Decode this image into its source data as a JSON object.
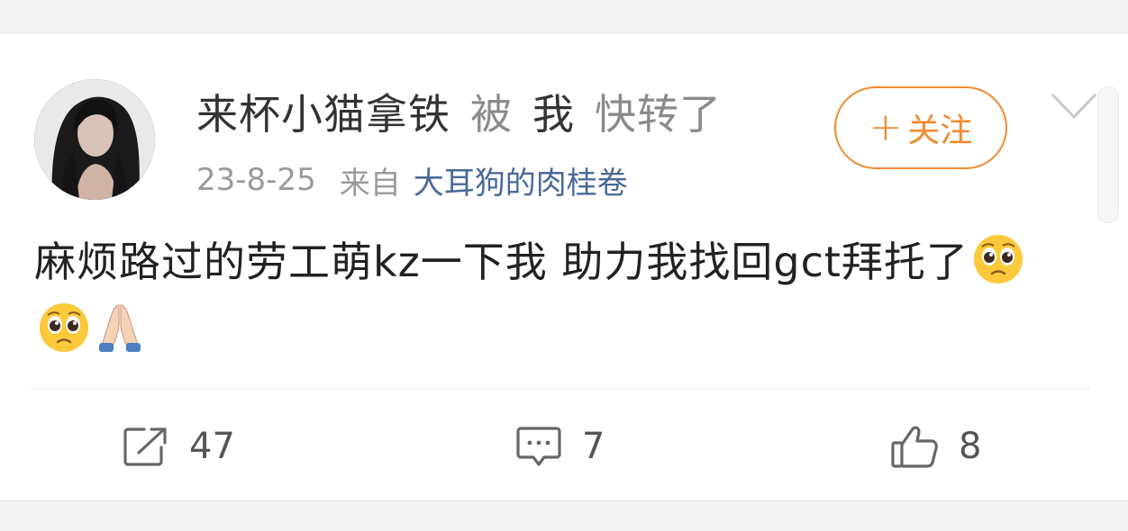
{
  "post": {
    "author_name": "来杯小猫拿铁",
    "repost_verb": "被",
    "repost_actor": "我",
    "repost_suffix": "快转了",
    "date": "23-8-25",
    "source_label": "来自",
    "source_name": "大耳狗的肉桂卷",
    "text": "麻烦路过的劳工萌kz一下我 助力我找回gct拜托了",
    "emojis": [
      "pleading-face-emoji",
      "pleading-face-emoji",
      "folded-hands-emoji"
    ]
  },
  "follow_button": {
    "plus": "+",
    "label": "关注"
  },
  "actions": {
    "repost_count": "47",
    "comment_count": "7",
    "like_count": "8"
  },
  "colors": {
    "accent_orange": "#f08a30",
    "link_blue": "#4a6a97",
    "text_dark": "#333333",
    "text_grey": "#8a8a8a"
  },
  "icons": [
    "avatar",
    "chevron-down-icon",
    "repost-icon",
    "comment-icon",
    "like-icon"
  ]
}
